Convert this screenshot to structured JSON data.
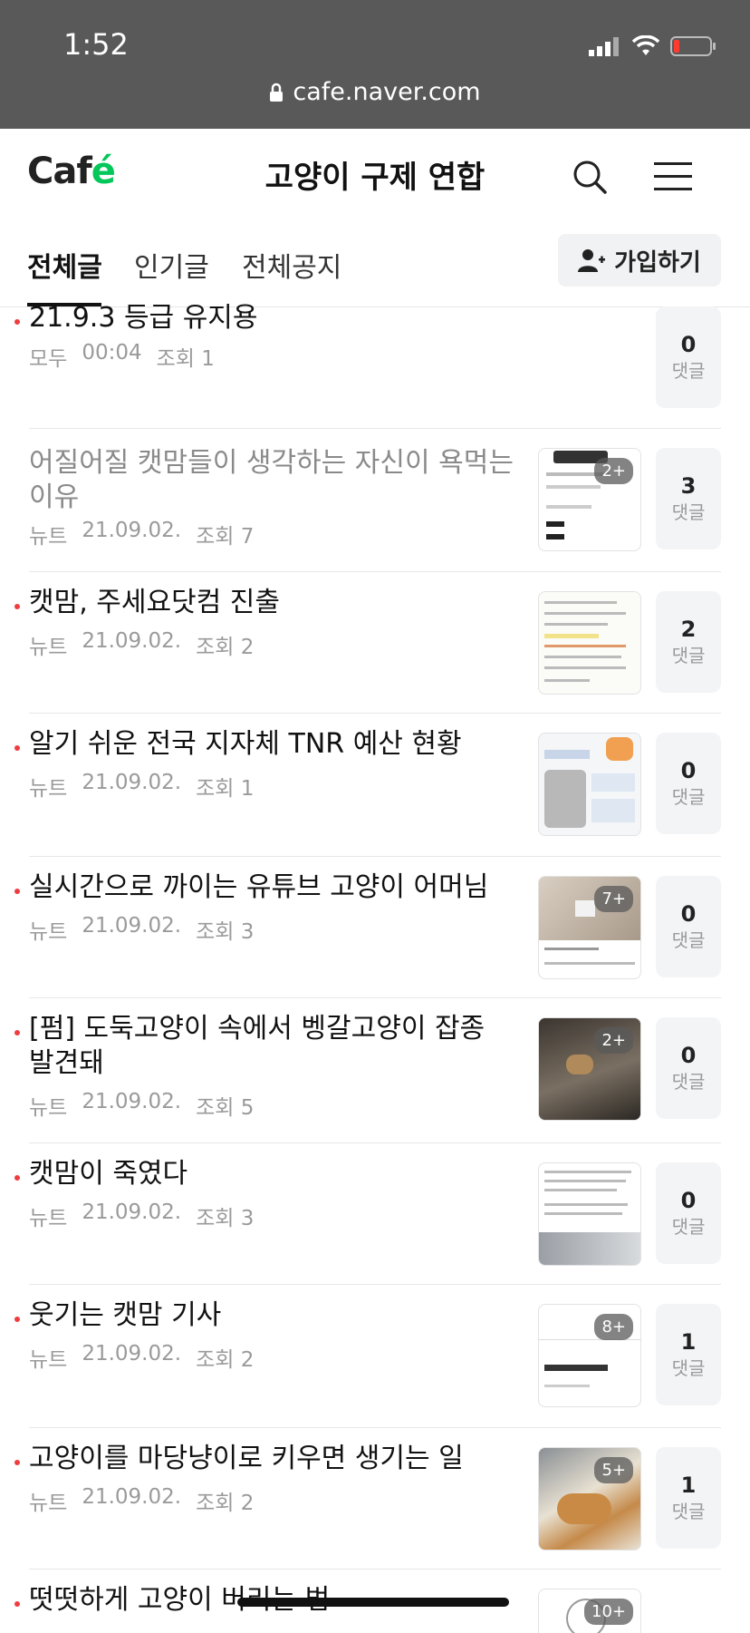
{
  "status": {
    "time": "1:52"
  },
  "browser": {
    "url": "cafe.naver.com"
  },
  "header": {
    "logo": "Caf",
    "logo_accent": "é",
    "title": "고양이 구제 연합"
  },
  "tabs": [
    {
      "label": "전체글",
      "active": true
    },
    {
      "label": "인기글",
      "active": false
    },
    {
      "label": "전체공지",
      "active": false
    }
  ],
  "join_label": "가입하기",
  "comment_label": "댓글",
  "posts": [
    {
      "title": "21.9.3 등급 유지용",
      "author": "모두",
      "date": "00:04",
      "views": "조회 1",
      "comments": "0",
      "thumb": false,
      "badge": ""
    },
    {
      "title": "어질어질 캣맘들이 생각하는 자신이 욕먹는 이유",
      "author": "뉴트",
      "date": "21.09.02.",
      "views": "조회 7",
      "comments": "3",
      "thumb": true,
      "badge": "2+"
    },
    {
      "title": "캣맘, 주세요닷컴 진출",
      "author": "뉴트",
      "date": "21.09.02.",
      "views": "조회 2",
      "comments": "2",
      "thumb": true,
      "badge": ""
    },
    {
      "title": "알기 쉬운 전국 지자체 TNR 예산 현황",
      "author": "뉴트",
      "date": "21.09.02.",
      "views": "조회 1",
      "comments": "0",
      "thumb": true,
      "badge": ""
    },
    {
      "title": "실시간으로 까이는 유튜브 고양이 어머님",
      "author": "뉴트",
      "date": "21.09.02.",
      "views": "조회 3",
      "comments": "0",
      "thumb": true,
      "badge": "7+"
    },
    {
      "title": "[펌] 도둑고양이 속에서 벵갈고양이 잡종 발견돼",
      "author": "뉴트",
      "date": "21.09.02.",
      "views": "조회 5",
      "comments": "0",
      "thumb": true,
      "badge": "2+"
    },
    {
      "title": "캣맘이 죽였다",
      "author": "뉴트",
      "date": "21.09.02.",
      "views": "조회 3",
      "comments": "0",
      "thumb": true,
      "badge": ""
    },
    {
      "title": "웃기는 캣맘 기사",
      "author": "뉴트",
      "date": "21.09.02.",
      "views": "조회 2",
      "comments": "1",
      "thumb": true,
      "badge": "8+"
    },
    {
      "title": "고양이를 마당냥이로 키우면 생기는 일",
      "author": "뉴트",
      "date": "21.09.02.",
      "views": "조회 2",
      "comments": "1",
      "thumb": true,
      "badge": "5+"
    },
    {
      "title": "떳떳하게 고양이 버리는 법",
      "author": "",
      "date": "",
      "views": "",
      "comments": "",
      "thumb": true,
      "badge": "10+"
    }
  ]
}
